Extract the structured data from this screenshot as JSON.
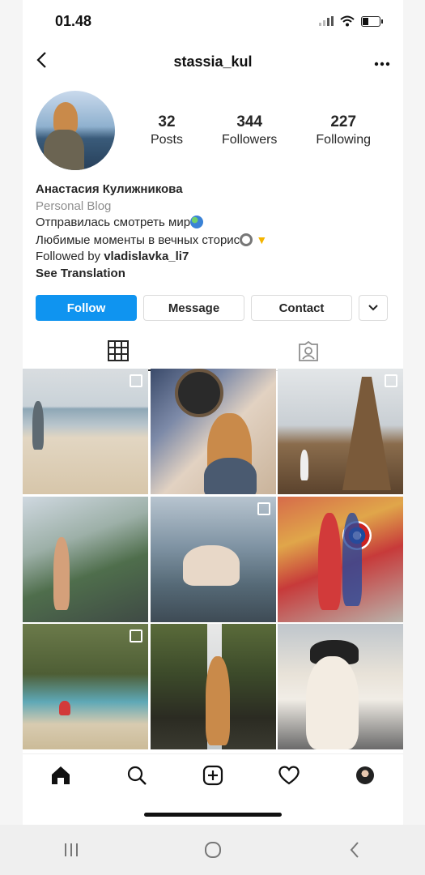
{
  "status_bar": {
    "time": "01.48"
  },
  "header": {
    "username": "stassia_kul",
    "back_icon": "back-arrow-icon",
    "more_icon": "more-dots-icon"
  },
  "profile": {
    "stats": [
      {
        "value": "32",
        "label": "Posts"
      },
      {
        "value": "344",
        "label": "Followers"
      },
      {
        "value": "227",
        "label": "Following"
      }
    ]
  },
  "bio": {
    "name": "Анастасия Кулижникова",
    "category": "Personal Blog",
    "line1": "Отправилась смотреть мир",
    "line2": "Любимые моменты в вечных сторис",
    "followed_prefix": "Followed by ",
    "followed_user": "vladislavka_li7",
    "see_translation": "See Translation"
  },
  "actions": {
    "follow": "Follow",
    "message": "Message",
    "contact": "Contact"
  },
  "tabs": [
    "grid",
    "tagged"
  ],
  "colors": {
    "accent": "#0f94f0",
    "text": "#262626",
    "muted": "#8e8e8e"
  },
  "bottom_nav": [
    "home-icon",
    "search-icon",
    "add-icon",
    "heart-icon",
    "profile-icon"
  ],
  "system_nav": [
    "recents-icon",
    "home-circle-icon",
    "back-icon"
  ]
}
